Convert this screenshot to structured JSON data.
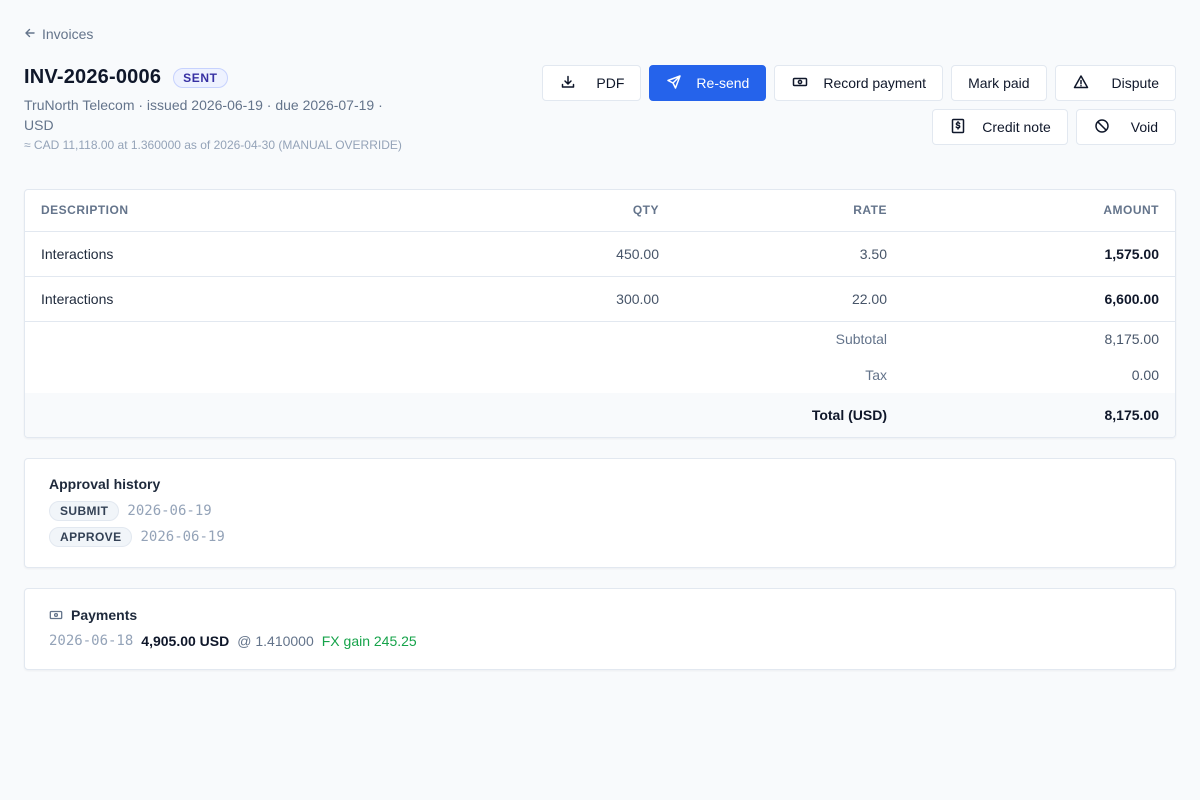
{
  "nav": {
    "back_label": "Invoices"
  },
  "invoice": {
    "number": "INV-2026-0006",
    "status": "SENT",
    "summary": "TruNorth Telecom · issued 2026-06-19 · due 2026-07-19 · USD",
    "fx_note": "≈ CAD 11,118.00 at 1.360000 as of 2026-04-30 (MANUAL OVERRIDE)"
  },
  "actions": {
    "pdf": "PDF",
    "resend": "Re-send",
    "record_payment": "Record payment",
    "mark_paid": "Mark paid",
    "dispute": "Dispute",
    "credit_note": "Credit note",
    "void": "Void"
  },
  "line_items": {
    "columns": {
      "description": "DESCRIPTION",
      "qty": "QTY",
      "rate": "RATE",
      "amount": "AMOUNT"
    },
    "rows": [
      {
        "description": "Interactions",
        "qty": "450.00",
        "rate": "3.50",
        "amount": "1,575.00"
      },
      {
        "description": "Interactions",
        "qty": "300.00",
        "rate": "22.00",
        "amount": "6,600.00"
      }
    ],
    "subtotal_label": "Subtotal",
    "subtotal": "8,175.00",
    "tax_label": "Tax",
    "tax": "0.00",
    "total_label": "Total (USD)",
    "total": "8,175.00"
  },
  "approval": {
    "title": "Approval history",
    "entries": [
      {
        "action": "SUBMIT",
        "date": "2026-06-19"
      },
      {
        "action": "APPROVE",
        "date": "2026-06-19"
      }
    ]
  },
  "payments": {
    "title": "Payments",
    "entries": [
      {
        "date": "2026-06-18",
        "amount": "4,905.00 USD",
        "rate": "@ 1.410000",
        "fx": "FX gain 245.25"
      }
    ]
  },
  "colors": {
    "primary": "#2563eb",
    "status_badge": "#3730a3",
    "fx_gain": "#16a34a",
    "background": "#f8fafc"
  },
  "icons": {
    "back": "arrow-left-icon",
    "pdf": "download-icon",
    "resend": "send-icon",
    "record_payment": "cash-icon",
    "dispute": "warning-triangle-icon",
    "credit_note": "dollar-document-icon",
    "void": "ban-icon",
    "payments": "cash-icon"
  }
}
